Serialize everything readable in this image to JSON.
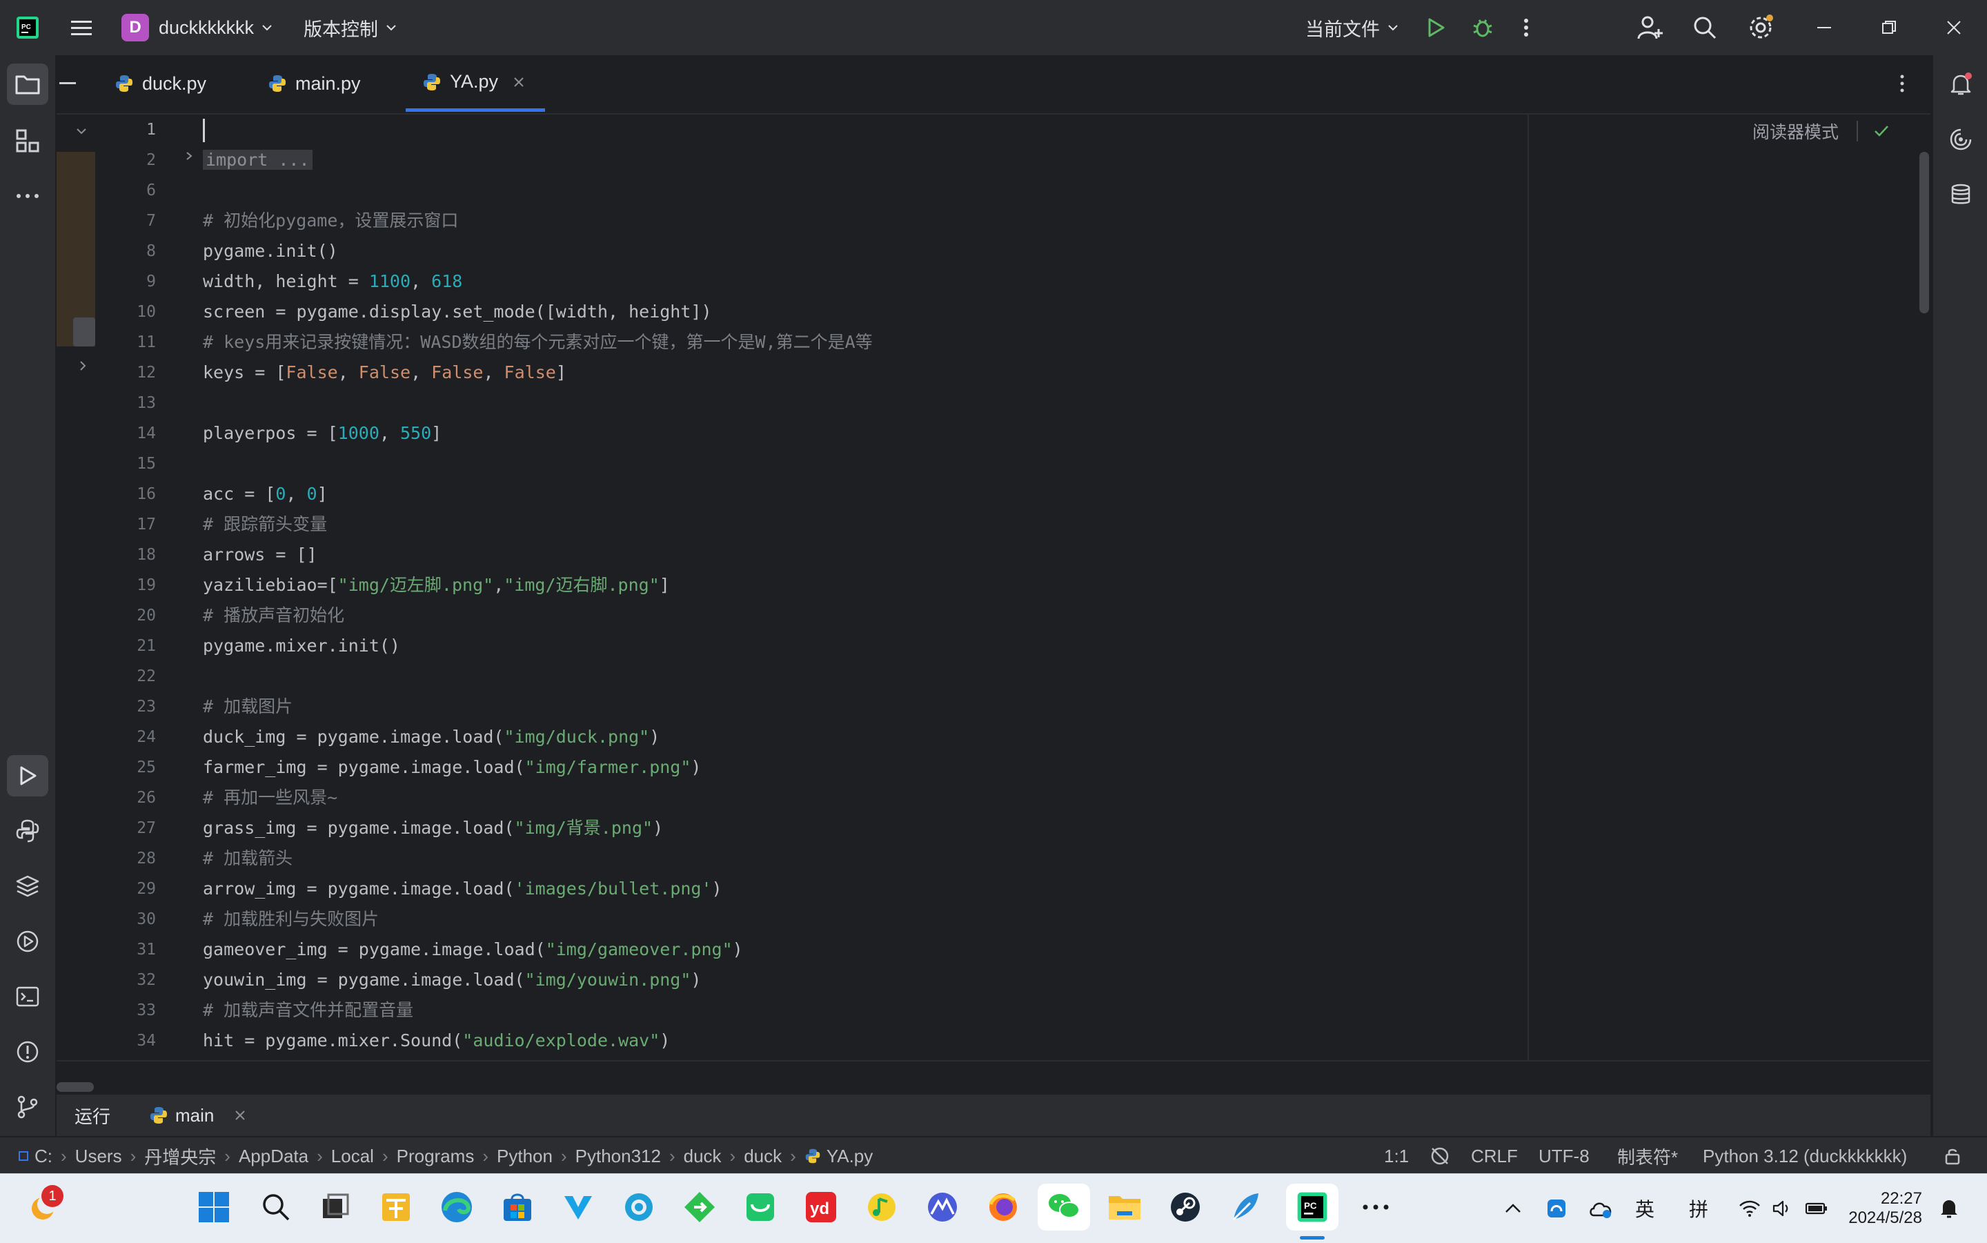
{
  "titlebar": {
    "project_letter": "D",
    "project_name": "duckkkkkkk",
    "vcs_menu": "版本控制",
    "run_config": "当前文件"
  },
  "tabs": [
    {
      "label": "duck.py",
      "active": false
    },
    {
      "label": "main.py",
      "active": false
    },
    {
      "label": "YA.py",
      "active": true
    }
  ],
  "editor": {
    "reader_mode": "阅读器模式",
    "line_numbers": [
      "1",
      "2",
      "6",
      "7",
      "8",
      "9",
      "10",
      "11",
      "12",
      "13",
      "14",
      "15",
      "16",
      "17",
      "18",
      "19",
      "20",
      "21",
      "22",
      "23",
      "24",
      "25",
      "26",
      "27",
      "28",
      "29",
      "30",
      "31",
      "32",
      "33",
      "34"
    ],
    "lines": [
      [],
      [
        {
          "t": "fold",
          "v": "import ..."
        }
      ],
      [],
      [
        {
          "t": "c",
          "v": "# 初始化pygame，设置展示窗口"
        }
      ],
      [
        {
          "t": "p",
          "v": "pygame.init()"
        }
      ],
      [
        {
          "t": "p",
          "v": "width, height = "
        },
        {
          "t": "n",
          "v": "1100"
        },
        {
          "t": "p",
          "v": ", "
        },
        {
          "t": "n",
          "v": "618"
        }
      ],
      [
        {
          "t": "p",
          "v": "screen = pygame.display.set_mode([width, height])"
        }
      ],
      [
        {
          "t": "c",
          "v": "# keys用来记录按键情况：WASD数组的每个元素对应一个键，第一个是W,第二个是A等"
        }
      ],
      [
        {
          "t": "p",
          "v": "keys = ["
        },
        {
          "t": "k",
          "v": "False"
        },
        {
          "t": "p",
          "v": ", "
        },
        {
          "t": "k",
          "v": "False"
        },
        {
          "t": "p",
          "v": ", "
        },
        {
          "t": "k",
          "v": "False"
        },
        {
          "t": "p",
          "v": ", "
        },
        {
          "t": "k",
          "v": "False"
        },
        {
          "t": "p",
          "v": "]"
        }
      ],
      [],
      [
        {
          "t": "p",
          "v": "playerpos = ["
        },
        {
          "t": "n",
          "v": "1000"
        },
        {
          "t": "p",
          "v": ", "
        },
        {
          "t": "n",
          "v": "550"
        },
        {
          "t": "p",
          "v": "]"
        }
      ],
      [],
      [
        {
          "t": "p",
          "v": "acc = ["
        },
        {
          "t": "n",
          "v": "0"
        },
        {
          "t": "p",
          "v": ", "
        },
        {
          "t": "n",
          "v": "0"
        },
        {
          "t": "p",
          "v": "]"
        }
      ],
      [
        {
          "t": "c",
          "v": "# 跟踪箭头变量"
        }
      ],
      [
        {
          "t": "p",
          "v": "arrows = []"
        }
      ],
      [
        {
          "t": "p",
          "v": "yaziliebiao=["
        },
        {
          "t": "s",
          "v": "\"img/迈左脚.png\""
        },
        {
          "t": "p",
          "v": ","
        },
        {
          "t": "s",
          "v": "\"img/迈右脚.png\""
        },
        {
          "t": "p",
          "v": "]"
        }
      ],
      [
        {
          "t": "c",
          "v": "# 播放声音初始化"
        }
      ],
      [
        {
          "t": "p",
          "v": "pygame.mixer.init()"
        }
      ],
      [],
      [
        {
          "t": "c",
          "v": "# 加载图片"
        }
      ],
      [
        {
          "t": "p",
          "v": "duck_img = pygame.image.load("
        },
        {
          "t": "s",
          "v": "\"img/duck.png\""
        },
        {
          "t": "p",
          "v": ")"
        }
      ],
      [
        {
          "t": "p",
          "v": "farmer_img = pygame.image.load("
        },
        {
          "t": "s",
          "v": "\"img/farmer.png\""
        },
        {
          "t": "p",
          "v": ")"
        }
      ],
      [
        {
          "t": "c",
          "v": "# 再加一些风景~"
        }
      ],
      [
        {
          "t": "p",
          "v": "grass_img = pygame.image.load("
        },
        {
          "t": "s",
          "v": "\"img/背景.png\""
        },
        {
          "t": "p",
          "v": ")"
        }
      ],
      [
        {
          "t": "c",
          "v": "# 加载箭头"
        }
      ],
      [
        {
          "t": "p",
          "v": "arrow_img = pygame.image.load("
        },
        {
          "t": "s",
          "v": "'images/bullet.png'"
        },
        {
          "t": "p",
          "v": ")"
        }
      ],
      [
        {
          "t": "c",
          "v": "# 加载胜利与失败图片"
        }
      ],
      [
        {
          "t": "p",
          "v": "gameover_img = pygame.image.load("
        },
        {
          "t": "s",
          "v": "\"img/gameover.png\""
        },
        {
          "t": "p",
          "v": ")"
        }
      ],
      [
        {
          "t": "p",
          "v": "youwin_img = pygame.image.load("
        },
        {
          "t": "s",
          "v": "\"img/youwin.png\""
        },
        {
          "t": "p",
          "v": ")"
        }
      ],
      [
        {
          "t": "c",
          "v": "# 加载声音文件并配置音量"
        }
      ],
      [
        {
          "t": "p",
          "v": "hit = pygame.mixer.Sound("
        },
        {
          "t": "s",
          "v": "\"audio/explode.wav\""
        },
        {
          "t": "p",
          "v": ")"
        }
      ]
    ]
  },
  "runbar": {
    "title": "运行",
    "tab": "main"
  },
  "statusbar": {
    "breadcrumbs": [
      "C:",
      "Users",
      "丹增央宗",
      "AppData",
      "Local",
      "Programs",
      "Python",
      "Python312",
      "duck",
      "duck",
      "YA.py"
    ],
    "position": "1:1",
    "line_sep": "CRLF",
    "encoding": "UTF-8",
    "indent": "制表符*",
    "interpreter": "Python 3.12 (duckkkkkkk)"
  },
  "taskbar": {
    "notification_count": "1",
    "ime_lang": "英",
    "ime_mode": "拼",
    "time": "22:27",
    "date": "2024/5/28"
  },
  "colors": {
    "accent": "#3574f0",
    "run_green": "#5fb865",
    "comment": "#7a7e85",
    "number": "#2aacb8",
    "string": "#6aab73",
    "keyword": "#cf8e6d"
  }
}
